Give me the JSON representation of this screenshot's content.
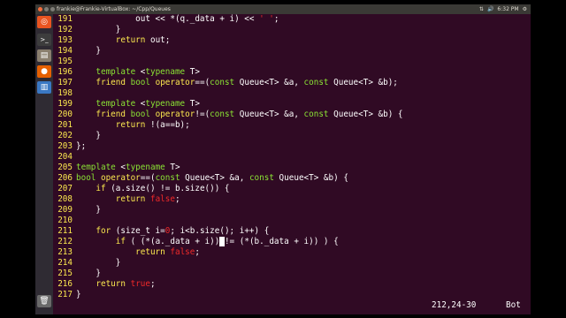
{
  "topbar": {
    "title": "frankie@Frankie-VirtualBox: ~/Cpp/Queues",
    "indicators": [
      "⇅",
      "🔊",
      "6:32 PM",
      "⚙"
    ]
  },
  "launcher": {
    "apps": [
      {
        "name": "ubuntu-logo",
        "glyph": "◎",
        "color": "#e95420"
      },
      {
        "name": "terminal",
        "glyph": ">_",
        "color": "#3d3d3d"
      },
      {
        "name": "files",
        "glyph": "▤",
        "color": "#8a7f6e"
      },
      {
        "name": "firefox",
        "glyph": "●",
        "color": "#e66000"
      },
      {
        "name": "writer",
        "glyph": "▥",
        "color": "#3a78c3"
      },
      {
        "name": "trash",
        "glyph": "🗑",
        "color": "#6a6a6a"
      }
    ]
  },
  "editor": {
    "lines": [
      {
        "num": "191",
        "tokens": [
          {
            "t": "            out << *(q._data + i) << "
          },
          {
            "t": "' '",
            "c": "st"
          },
          {
            "t": ";"
          }
        ]
      },
      {
        "num": "192",
        "tokens": [
          {
            "t": "        }"
          }
        ]
      },
      {
        "num": "193",
        "tokens": [
          {
            "t": "        "
          },
          {
            "t": "return",
            "c": "kw"
          },
          {
            "t": " out;"
          }
        ]
      },
      {
        "num": "194",
        "tokens": [
          {
            "t": "    }"
          }
        ]
      },
      {
        "num": "195",
        "tokens": []
      },
      {
        "num": "196",
        "tokens": [
          {
            "t": "    "
          },
          {
            "t": "template",
            "c": "ty"
          },
          {
            "t": " <"
          },
          {
            "t": "typename",
            "c": "ty"
          },
          {
            "t": " T>"
          }
        ]
      },
      {
        "num": "197",
        "tokens": [
          {
            "t": "    "
          },
          {
            "t": "friend",
            "c": "kw"
          },
          {
            "t": " "
          },
          {
            "t": "bool",
            "c": "ty"
          },
          {
            "t": " "
          },
          {
            "t": "operator",
            "c": "kw"
          },
          {
            "t": "==("
          },
          {
            "t": "const",
            "c": "ty"
          },
          {
            "t": " Queue<T> &a, "
          },
          {
            "t": "const",
            "c": "ty"
          },
          {
            "t": " Queue<T> &b);"
          }
        ]
      },
      {
        "num": "198",
        "tokens": []
      },
      {
        "num": "199",
        "tokens": [
          {
            "t": "    "
          },
          {
            "t": "template",
            "c": "ty"
          },
          {
            "t": " <"
          },
          {
            "t": "typename",
            "c": "ty"
          },
          {
            "t": " T>"
          }
        ]
      },
      {
        "num": "200",
        "tokens": [
          {
            "t": "    "
          },
          {
            "t": "friend",
            "c": "kw"
          },
          {
            "t": " "
          },
          {
            "t": "bool",
            "c": "ty"
          },
          {
            "t": " "
          },
          {
            "t": "operator",
            "c": "kw"
          },
          {
            "t": "!=("
          },
          {
            "t": "const",
            "c": "ty"
          },
          {
            "t": " Queue<T> &a, "
          },
          {
            "t": "const",
            "c": "ty"
          },
          {
            "t": " Queue<T> &b) {"
          }
        ]
      },
      {
        "num": "201",
        "tokens": [
          {
            "t": "        "
          },
          {
            "t": "return",
            "c": "kw"
          },
          {
            "t": " !(a==b);"
          }
        ]
      },
      {
        "num": "202",
        "tokens": [
          {
            "t": "    }"
          }
        ]
      },
      {
        "num": "203",
        "tokens": [
          {
            "t": "};"
          }
        ]
      },
      {
        "num": "204",
        "tokens": []
      },
      {
        "num": "205",
        "tokens": [
          {
            "t": "template",
            "c": "ty"
          },
          {
            "t": " <"
          },
          {
            "t": "typename",
            "c": "ty"
          },
          {
            "t": " T>"
          }
        ]
      },
      {
        "num": "206",
        "tokens": [
          {
            "t": "bool",
            "c": "ty"
          },
          {
            "t": " "
          },
          {
            "t": "operator",
            "c": "kw"
          },
          {
            "t": "==("
          },
          {
            "t": "const",
            "c": "ty"
          },
          {
            "t": " Queue<T> &a, "
          },
          {
            "t": "const",
            "c": "ty"
          },
          {
            "t": " Queue<T> &b) {"
          }
        ]
      },
      {
        "num": "207",
        "tokens": [
          {
            "t": "    "
          },
          {
            "t": "if",
            "c": "kw"
          },
          {
            "t": " (a.size() != b.size()) {"
          }
        ]
      },
      {
        "num": "208",
        "tokens": [
          {
            "t": "        "
          },
          {
            "t": "return",
            "c": "kw"
          },
          {
            "t": " "
          },
          {
            "t": "false",
            "c": "st"
          },
          {
            "t": ";"
          }
        ]
      },
      {
        "num": "209",
        "tokens": [
          {
            "t": "    }"
          }
        ]
      },
      {
        "num": "210",
        "tokens": []
      },
      {
        "num": "211",
        "tokens": [
          {
            "t": "    "
          },
          {
            "t": "for",
            "c": "kw"
          },
          {
            "t": " (size_t i="
          },
          {
            "t": "0",
            "c": "st"
          },
          {
            "t": "; i<b.size(); i++) {"
          }
        ]
      },
      {
        "num": "212",
        "tokens": [
          {
            "t": "        "
          },
          {
            "t": "if",
            "c": "kw"
          },
          {
            "t": " ( (*(a._data + i))"
          },
          {
            "t": " ",
            "c": "cursor"
          },
          {
            "t": "!= (*(b._data + i)) ) {"
          }
        ]
      },
      {
        "num": "213",
        "tokens": [
          {
            "t": "            "
          },
          {
            "t": "return",
            "c": "kw"
          },
          {
            "t": " "
          },
          {
            "t": "false",
            "c": "st"
          },
          {
            "t": ";"
          }
        ]
      },
      {
        "num": "214",
        "tokens": [
          {
            "t": "        }"
          }
        ]
      },
      {
        "num": "215",
        "tokens": [
          {
            "t": "    }"
          }
        ]
      },
      {
        "num": "216",
        "tokens": [
          {
            "t": "    "
          },
          {
            "t": "return",
            "c": "kw"
          },
          {
            "t": " "
          },
          {
            "t": "true",
            "c": "st"
          },
          {
            "t": ";"
          }
        ]
      },
      {
        "num": "217",
        "tokens": [
          {
            "t": "}"
          }
        ]
      }
    ]
  },
  "status": {
    "position": "212,24-30",
    "scroll": "Bot"
  }
}
